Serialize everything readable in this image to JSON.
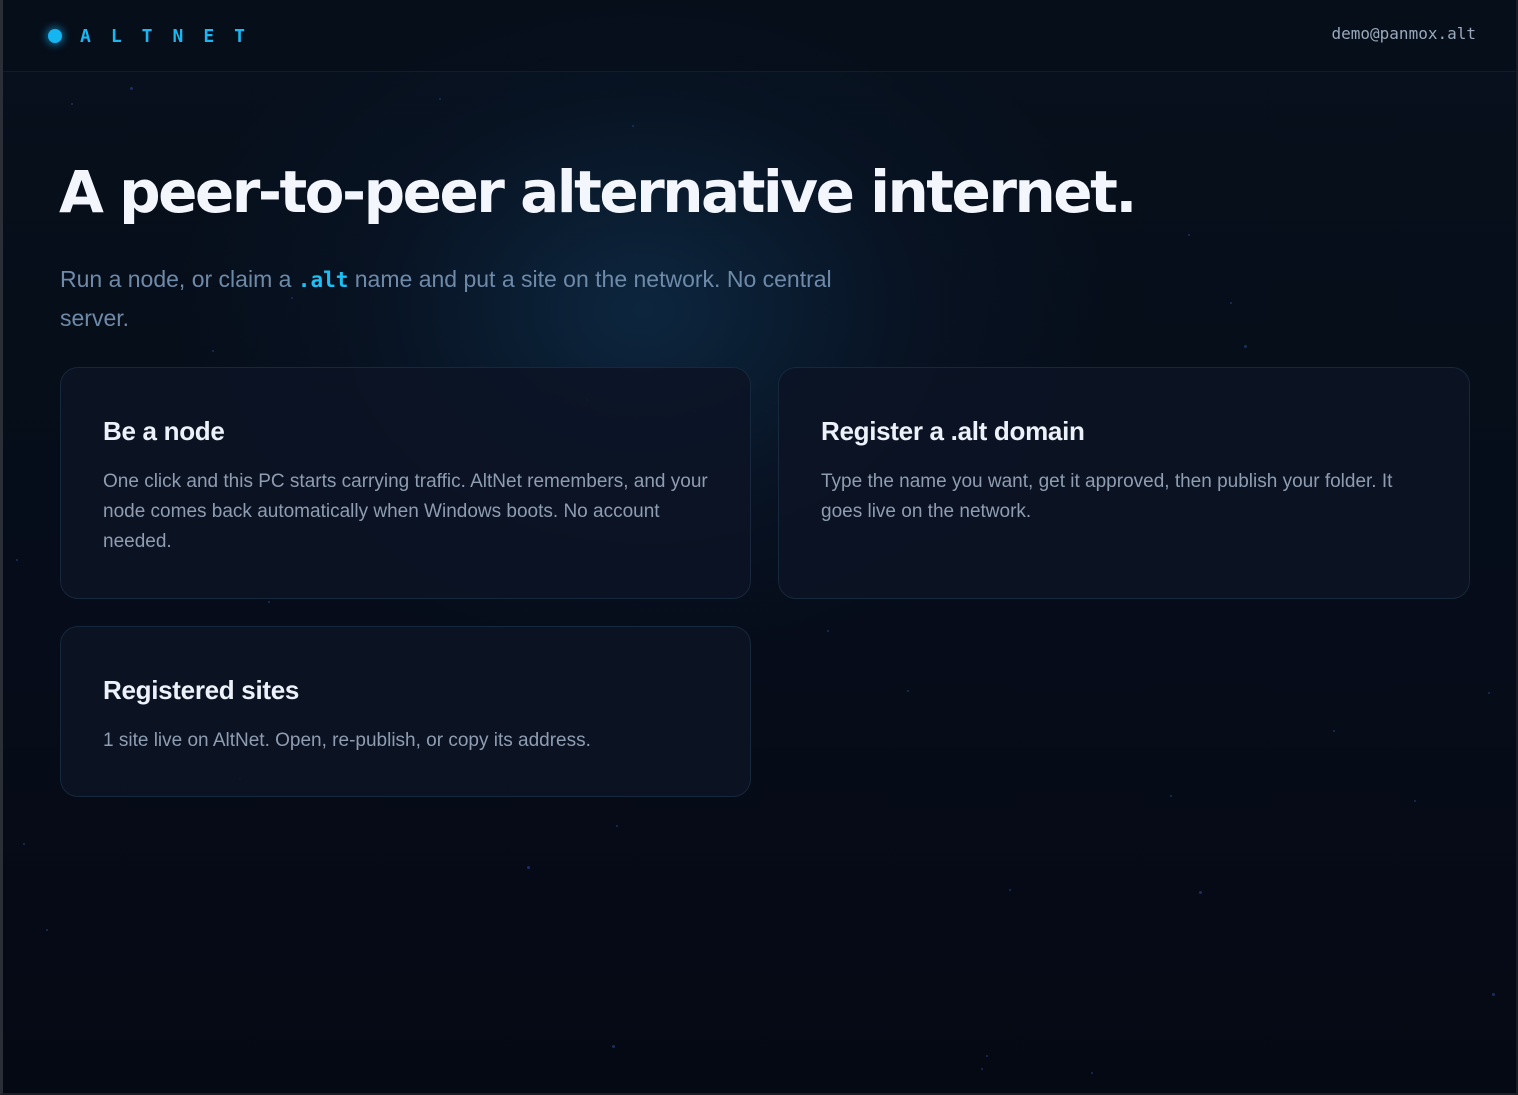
{
  "brand": {
    "name": "ALTNET",
    "accent": "#15b5f2"
  },
  "header": {
    "user_email": "demo@panmox.alt"
  },
  "hero": {
    "title": "A peer-to-peer alternative internet.",
    "subtitle_before": "Run a node, or claim a ",
    "subtitle_code": ".alt",
    "subtitle_after": " name and put a site on the network. No central server."
  },
  "cards": [
    {
      "title": "Be a node",
      "description": "One click and this PC starts carrying traffic. AltNet remembers, and your node comes back automatically when Windows boots. No account needed."
    },
    {
      "title": "Register a .alt domain",
      "description": "Type the name you want, get it approved, then publish your folder. It goes live on the network."
    },
    {
      "title": "Registered sites",
      "description": "1 site live on AltNet. Open, re-publish, or copy its address."
    }
  ],
  "colors": {
    "background": "#060b17",
    "card_background": "#0c1324",
    "card_border": "#16283b",
    "title_text": "#f3f6fc",
    "muted_text": "#8e9db2",
    "code_text": "#1cc0f7"
  }
}
